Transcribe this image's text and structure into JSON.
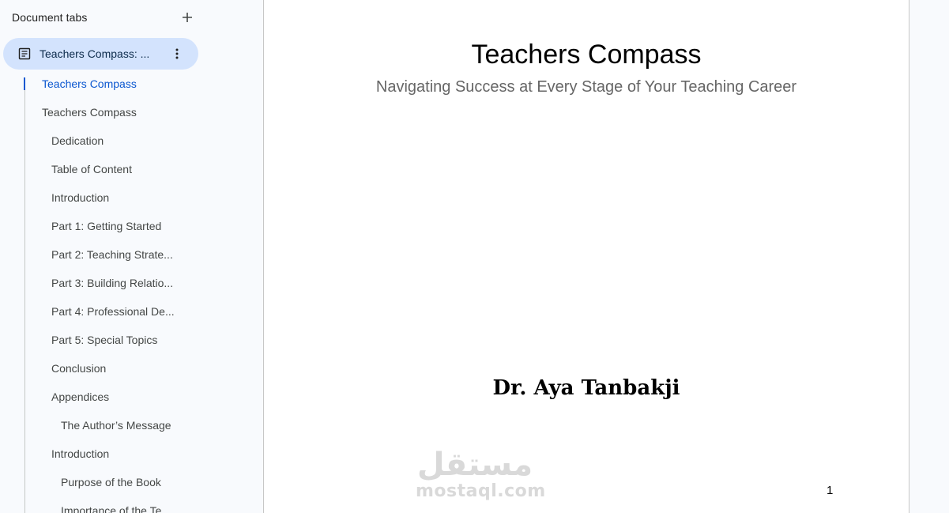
{
  "sidebar": {
    "title": "Document tabs",
    "active_tab": {
      "label": "Teachers Compass: ..."
    },
    "outline": [
      {
        "label": "Teachers Compass",
        "level": 1,
        "active": true
      },
      {
        "label": "Teachers Compass",
        "level": 1
      },
      {
        "label": "Dedication",
        "level": 2
      },
      {
        "label": "Table of Content",
        "level": 2
      },
      {
        "label": "Introduction",
        "level": 2
      },
      {
        "label": "Part 1: Getting Started",
        "level": 2
      },
      {
        "label": "Part 2: Teaching Strate...",
        "level": 2
      },
      {
        "label": "Part 3: Building Relatio...",
        "level": 2
      },
      {
        "label": "Part 4: Professional De...",
        "level": 2
      },
      {
        "label": "Part 5: Special Topics",
        "level": 2
      },
      {
        "label": "Conclusion",
        "level": 2
      },
      {
        "label": "Appendices",
        "level": 2
      },
      {
        "label": "The Author’s Message",
        "level": 3
      },
      {
        "label": "Introduction",
        "level": 2
      },
      {
        "label": "Purpose of the Book",
        "level": 3
      },
      {
        "label": "Importance of the Te",
        "level": 3
      }
    ],
    "icons": {
      "add": "plus-icon",
      "document": "document-icon",
      "more": "more-vert-icon"
    }
  },
  "document": {
    "title": "Teachers Compass",
    "subtitle": "Navigating Success at Every Stage of Your Teaching Career",
    "author": "Dr. Aya Tanbakji",
    "page_number": "1"
  },
  "watermark": {
    "arabic": "مستقل",
    "latin": "mostaql.com"
  },
  "colors": {
    "accent": "#0b57d0",
    "tab_chip_bg": "#d3e3fd",
    "sidebar_bg": "#f8fafd",
    "subtitle": "#666666"
  }
}
